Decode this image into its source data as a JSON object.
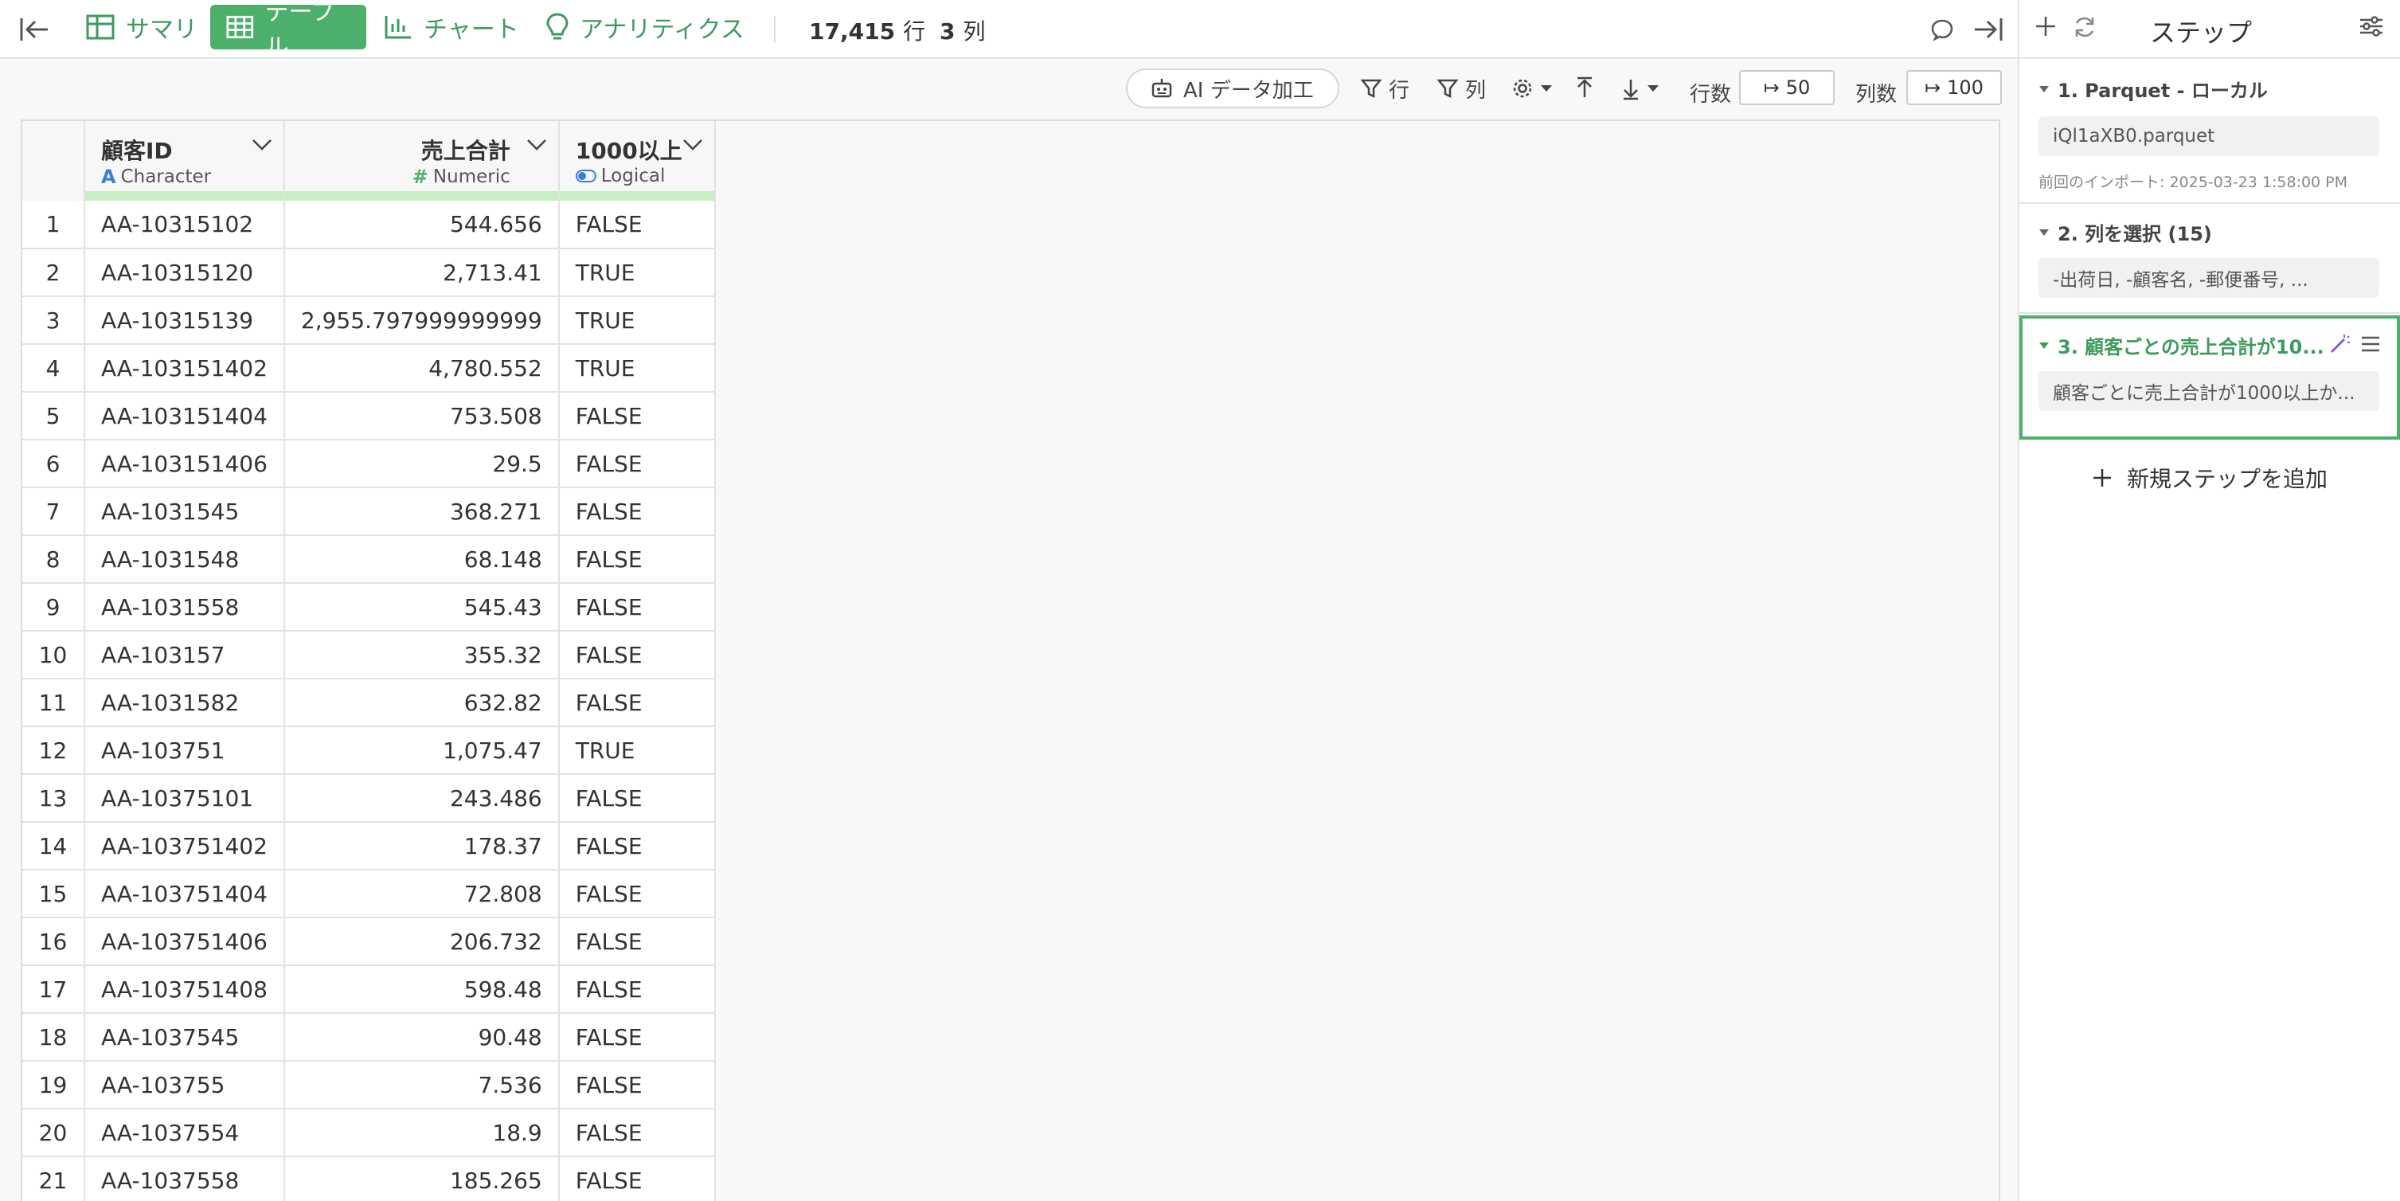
{
  "topbar": {
    "tabs": [
      {
        "label": "サマリ",
        "icon": "summary-grid-icon",
        "active": false
      },
      {
        "label": "テーブル",
        "icon": "table-icon",
        "active": true
      },
      {
        "label": "チャート",
        "icon": "bar-chart-icon",
        "active": false
      },
      {
        "label": "アナリティクス",
        "icon": "bulb-icon",
        "active": false
      }
    ],
    "rows_count": "17,415",
    "rows_unit": "行",
    "cols_count": "3",
    "cols_unit": "列"
  },
  "toolbar": {
    "ai_label": "AI データ加工",
    "filter_row_label": "行",
    "filter_col_label": "列",
    "rows_label": "行数",
    "rows_value": "50",
    "cols_label": "列数",
    "cols_value": "100"
  },
  "table": {
    "columns": [
      {
        "name": "顧客ID",
        "type": "Character",
        "type_icon": "A"
      },
      {
        "name": "売上合計",
        "type": "Numeric",
        "type_icon": "#"
      },
      {
        "name": "1000以上",
        "type": "Logical",
        "type_icon": "toggle"
      }
    ],
    "rows": [
      [
        "1",
        "AA-10315102",
        "544.656",
        "FALSE"
      ],
      [
        "2",
        "AA-10315120",
        "2,713.41",
        "TRUE"
      ],
      [
        "3",
        "AA-10315139",
        "2,955.797999999999",
        "TRUE"
      ],
      [
        "4",
        "AA-103151402",
        "4,780.552",
        "TRUE"
      ],
      [
        "5",
        "AA-103151404",
        "753.508",
        "FALSE"
      ],
      [
        "6",
        "AA-103151406",
        "29.5",
        "FALSE"
      ],
      [
        "7",
        "AA-1031545",
        "368.271",
        "FALSE"
      ],
      [
        "8",
        "AA-1031548",
        "68.148",
        "FALSE"
      ],
      [
        "9",
        "AA-1031558",
        "545.43",
        "FALSE"
      ],
      [
        "10",
        "AA-103157",
        "355.32",
        "FALSE"
      ],
      [
        "11",
        "AA-1031582",
        "632.82",
        "FALSE"
      ],
      [
        "12",
        "AA-103751",
        "1,075.47",
        "TRUE"
      ],
      [
        "13",
        "AA-10375101",
        "243.486",
        "FALSE"
      ],
      [
        "14",
        "AA-103751402",
        "178.37",
        "FALSE"
      ],
      [
        "15",
        "AA-103751404",
        "72.808",
        "FALSE"
      ],
      [
        "16",
        "AA-103751406",
        "206.732",
        "FALSE"
      ],
      [
        "17",
        "AA-103751408",
        "598.48",
        "FALSE"
      ],
      [
        "18",
        "AA-1037545",
        "90.48",
        "FALSE"
      ],
      [
        "19",
        "AA-103755",
        "7.536",
        "FALSE"
      ],
      [
        "20",
        "AA-1037554",
        "18.9",
        "FALSE"
      ],
      [
        "21",
        "AA-1037558",
        "185.265",
        "FALSE"
      ]
    ]
  },
  "panel": {
    "title": "ステップ",
    "steps": [
      {
        "title": "1. Parquet - ローカル",
        "box": "iQl1aXB0.parquet",
        "meta": "前回のインポート: 2025-03-23 1:58:00 PM"
      },
      {
        "title": "2. 列を選択 (15)",
        "box": "-出荷日, -顧客名, -郵便番号, ..."
      },
      {
        "title": "3. 顧客ごとの売上合計が10...",
        "box": "顧客ごとに売上合計が1000以上か..."
      }
    ],
    "add_step_label": "新規ステップを追加",
    "accent": "#4caf6a"
  }
}
